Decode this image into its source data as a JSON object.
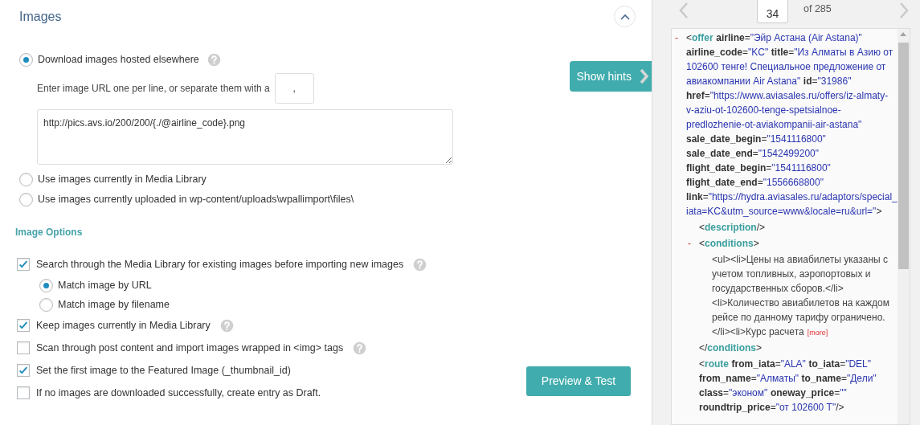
{
  "section": {
    "title": "Images"
  },
  "image_sources": [
    {
      "label": "Download images hosted elsewhere",
      "selected": true,
      "help": true,
      "separator_label": "Enter image URL one per line, or separate them with a",
      "separator_value": ",",
      "urls_value": "http://pics.avs.io/200/200/{./@airline_code}.png"
    },
    {
      "label": "Use images currently in Media Library",
      "selected": false,
      "help": false
    },
    {
      "label": "Use images currently uploaded in wp-content/uploads\\wpallimport\\files\\",
      "selected": false,
      "help": false
    }
  ],
  "options_title": "Image Options",
  "options": [
    {
      "label": "Search through the Media Library for existing images before importing new images",
      "checked": true,
      "help": true,
      "choices": [
        {
          "label": "Match image by URL",
          "selected": true
        },
        {
          "label": "Match image by filename",
          "selected": false
        }
      ]
    },
    {
      "label": "Keep images currently in Media Library",
      "checked": true,
      "help": true
    },
    {
      "label": "Scan through post content and import images wrapped in <img> tags",
      "checked": false,
      "help": true
    },
    {
      "label": "Set the first image to the Featured Image (_thumbnail_id)",
      "checked": true,
      "help": false
    },
    {
      "label": "If no images are downloaded successfully, create entry as Draft.",
      "checked": false,
      "help": false
    }
  ],
  "show_hints_button": "Show hints",
  "preview_button": "Preview & Test",
  "pager": {
    "current": "34",
    "total": "of 285"
  },
  "xml": {
    "toggle": "-",
    "lines": [
      [
        {
          "kind": "punct",
          "text": "<"
        },
        {
          "kind": "tag",
          "text": "offer"
        },
        {
          "kind": "attr",
          "text": "airline"
        },
        {
          "kind": "punct",
          "text": "="
        },
        {
          "kind": "value",
          "text": "\"Эйр Астана (Air Astana)\""
        }
      ],
      [
        {
          "kind": "attr",
          "text": "airline_code"
        },
        {
          "kind": "punct",
          "text": "="
        },
        {
          "kind": "value",
          "text": "\"KC\""
        },
        {
          "kind": "attr",
          "text": "title"
        },
        {
          "kind": "punct",
          "text": "="
        },
        {
          "kind": "value",
          "text": "\"Из Алматы в Азию от"
        }
      ],
      [
        {
          "kind": "value",
          "text": "102600 тенге! Специальное предложение от"
        }
      ],
      [
        {
          "kind": "value",
          "text": "авиакомпании Air Astana\""
        },
        {
          "kind": "attr",
          "text": "id"
        },
        {
          "kind": "punct",
          "text": "="
        },
        {
          "kind": "value",
          "text": "\"31986\""
        }
      ],
      [
        {
          "kind": "attr",
          "text": "href"
        },
        {
          "kind": "punct",
          "text": "="
        },
        {
          "kind": "value",
          "text": "\"https://www.aviasales.ru/offers/iz-almaty-"
        }
      ],
      [
        {
          "kind": "value",
          "text": "v-aziu-ot-102600-tenge-spetsialnoe-"
        }
      ],
      [
        {
          "kind": "value",
          "text": "predlozhenie-ot-aviakompanii-air-astana\""
        }
      ],
      [
        {
          "kind": "attr",
          "text": "sale_date_begin"
        },
        {
          "kind": "punct",
          "text": "="
        },
        {
          "kind": "value",
          "text": "\"1541116800\""
        }
      ],
      [
        {
          "kind": "attr",
          "text": "sale_date_end"
        },
        {
          "kind": "punct",
          "text": "="
        },
        {
          "kind": "value",
          "text": "\"1542499200\""
        }
      ],
      [
        {
          "kind": "attr",
          "text": "flight_date_begin"
        },
        {
          "kind": "punct",
          "text": "="
        },
        {
          "kind": "value",
          "text": "\"1541116800\""
        }
      ],
      [
        {
          "kind": "attr",
          "text": "flight_date_end"
        },
        {
          "kind": "punct",
          "text": "="
        },
        {
          "kind": "value",
          "text": "\"1556668800\""
        }
      ],
      [
        {
          "kind": "attr",
          "text": "link"
        },
        {
          "kind": "punct",
          "text": "="
        },
        {
          "kind": "value",
          "text": "\"https://hydra.aviasales.ru/adaptors/special_"
        }
      ],
      [
        {
          "kind": "value",
          "text": "iata=KC&utm_source=www&locale=ru&url=\""
        },
        {
          "kind": "punct",
          "text": ">"
        }
      ]
    ],
    "children": [
      {
        "lines": [
          [
            {
              "kind": "punct",
              "text": "<"
            },
            {
              "kind": "tag",
              "text": "description"
            },
            {
              "kind": "punct",
              "text": "/>"
            }
          ]
        ]
      },
      {
        "toggle": "-",
        "lines": [
          [
            {
              "kind": "punct",
              "text": "<"
            },
            {
              "kind": "tag",
              "text": "conditions"
            },
            {
              "kind": "punct",
              "text": ">"
            }
          ]
        ],
        "children": [
          {
            "lines": [
              [
                {
                  "kind": "text",
                  "text": "<ul><li>Цены на авиабилеты указаны с"
                }
              ],
              [
                {
                  "kind": "text",
                  "text": "учетом топливных, аэропортовых и"
                }
              ],
              [
                {
                  "kind": "text",
                  "text": "государственных сборов.</li>"
                }
              ],
              [
                {
                  "kind": "text",
                  "text": "<li>Количество авиабилетов на каждом"
                }
              ],
              [
                {
                  "kind": "text",
                  "text": "рейсе по данному тарифу ограничено."
                }
              ],
              [
                {
                  "kind": "text",
                  "text": "</li><li>Курс расчета"
                },
                {
                  "kind": "more",
                  "text": "[more]"
                }
              ]
            ]
          }
        ],
        "closing_lines": [
          [
            {
              "kind": "punct",
              "text": "</"
            },
            {
              "kind": "tag",
              "text": "conditions"
            },
            {
              "kind": "punct",
              "text": ">"
            }
          ]
        ]
      },
      {
        "lines": [
          [
            {
              "kind": "punct",
              "text": "<"
            },
            {
              "kind": "tag",
              "text": "route"
            },
            {
              "kind": "attr",
              "text": "from_iata"
            },
            {
              "kind": "punct",
              "text": "="
            },
            {
              "kind": "value",
              "text": "\"ALA\""
            },
            {
              "kind": "attr",
              "text": "to_iata"
            },
            {
              "kind": "punct",
              "text": "="
            },
            {
              "kind": "value",
              "text": "\"DEL\""
            }
          ],
          [
            {
              "kind": "attr",
              "text": "from_name"
            },
            {
              "kind": "punct",
              "text": "="
            },
            {
              "kind": "value",
              "text": "\"Алматы\""
            },
            {
              "kind": "attr",
              "text": "to_name"
            },
            {
              "kind": "punct",
              "text": "="
            },
            {
              "kind": "value",
              "text": "\"Дели\""
            }
          ],
          [
            {
              "kind": "attr",
              "text": "class"
            },
            {
              "kind": "punct",
              "text": "="
            },
            {
              "kind": "value",
              "text": "\"эконом\""
            },
            {
              "kind": "attr",
              "text": "oneway_price"
            },
            {
              "kind": "punct",
              "text": "="
            },
            {
              "kind": "value",
              "text": "\"\""
            }
          ],
          [
            {
              "kind": "attr",
              "text": "roundtrip_price"
            },
            {
              "kind": "punct",
              "text": "="
            },
            {
              "kind": "value",
              "text": "\"от 102600 T\""
            },
            {
              "kind": "punct",
              "text": "/>"
            }
          ]
        ]
      }
    ]
  }
}
